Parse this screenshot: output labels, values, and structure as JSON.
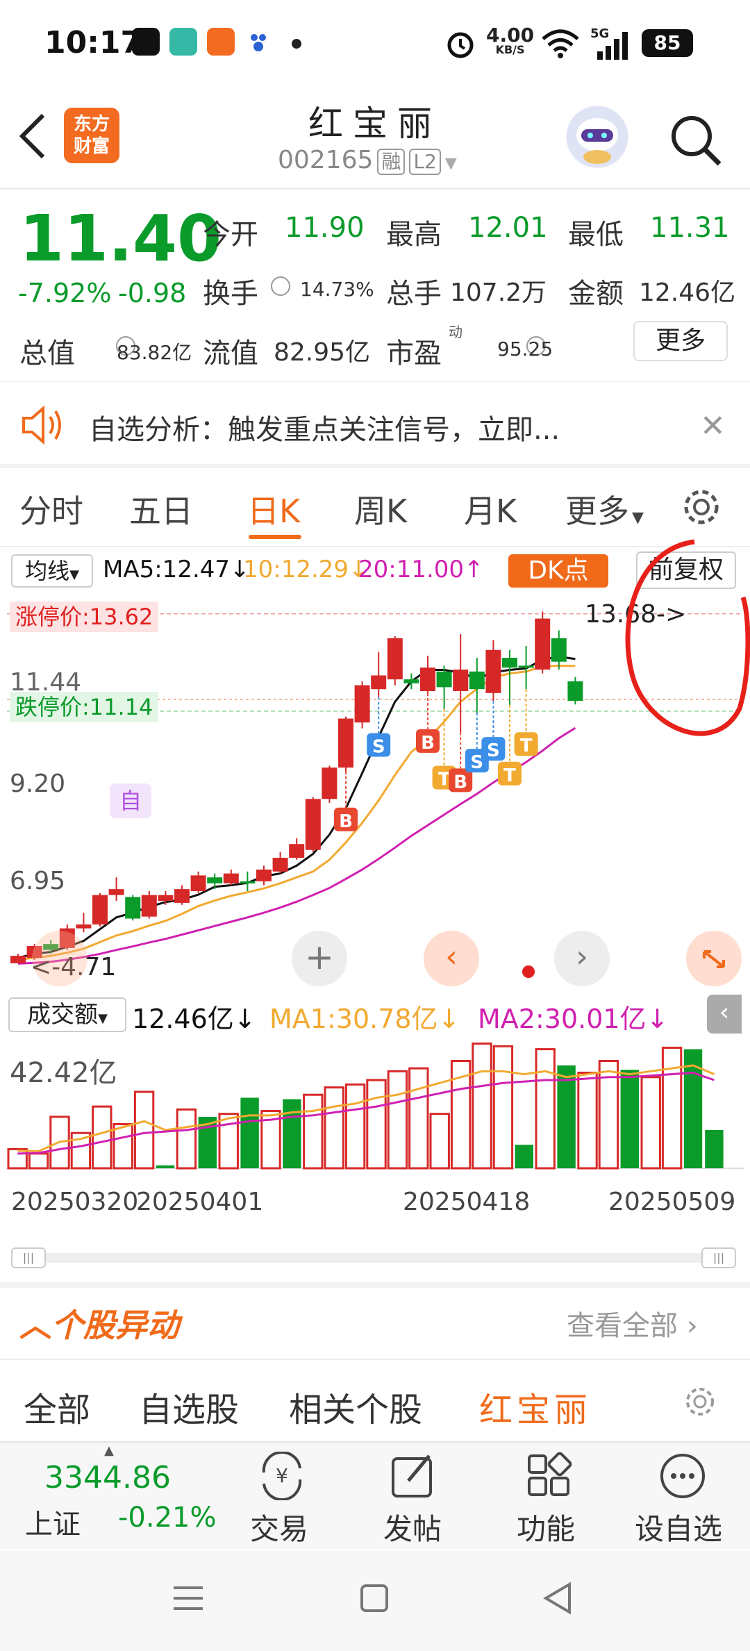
{
  "status_bar": {
    "time": "10:17",
    "net_speed": "4.00",
    "net_unit": "KB/S",
    "signal": "5G",
    "battery": "85"
  },
  "header": {
    "logo_line1": "东方",
    "logo_line2": "财富",
    "stock_name": "红宝丽",
    "stock_code": "002165",
    "tag_margin": "融",
    "tag_level": "L2"
  },
  "quote": {
    "price": "11.40",
    "change_pct": "-7.92%",
    "change_amt": "-0.98",
    "open_label": "今开",
    "open": "11.90",
    "high_label": "最高",
    "high": "12.01",
    "low_label": "最低",
    "low": "11.31",
    "turnover_label": "换手",
    "turnover": "14.73%",
    "volume_label": "总手",
    "volume": "107.2万",
    "amount_label": "金额",
    "amount": "12.46亿",
    "mktcap_label": "总值",
    "mktcap": "83.82亿",
    "float_label": "流值",
    "float": "82.95亿",
    "pe_label": "市盈",
    "pe_sup": "动",
    "pe": "95.25",
    "more": "更多"
  },
  "notice": {
    "text": "自选分析：触发重点关注信号，立即..."
  },
  "tabs": [
    {
      "label": "分时"
    },
    {
      "label": "五日"
    },
    {
      "label": "日K"
    },
    {
      "label": "周K"
    },
    {
      "label": "月K"
    },
    {
      "label": "更多"
    }
  ],
  "chart_toolbar": {
    "ma_select": "均线",
    "ma5": "MA5:12.47",
    "ma10": "10:12.29",
    "ma20": "20:11.00",
    "dk_button": "DK点",
    "fq_button": "前复权"
  },
  "chart_labels": {
    "limit_up": "涨停价:13.62",
    "limit_down": "跌停价:11.14",
    "y_top": "11.44",
    "y_mid": "9.20",
    "y_low": "6.95",
    "max_price": "13.68->",
    "min_price": "<-4.71",
    "self_marker": "自"
  },
  "volume_toolbar": {
    "select": "成交额",
    "value": "12.46亿",
    "ma1": "MA1:30.78亿",
    "ma2": "MA2:30.01亿",
    "max": "42.42亿"
  },
  "x_axis": [
    "20250320",
    "20250401",
    "20250418",
    "20250509"
  ],
  "colors": {
    "up": "#d72828",
    "down": "#0a9b2a",
    "accent": "#f06a1a",
    "ma5": "#111111",
    "ma10": "#f2a930",
    "ma20": "#d020b0"
  },
  "chart_data": {
    "type": "candlestick",
    "candles": [
      {
        "o": 4.71,
        "c": 4.9,
        "h": 4.95,
        "l": 4.71
      },
      {
        "o": 4.85,
        "c": 5.15,
        "h": 5.2,
        "l": 4.8
      },
      {
        "o": 5.2,
        "c": 5.05,
        "h": 5.3,
        "l": 4.95
      },
      {
        "o": 5.1,
        "c": 5.6,
        "h": 5.7,
        "l": 5.05
      },
      {
        "o": 5.6,
        "c": 5.7,
        "h": 6.0,
        "l": 5.5
      },
      {
        "o": 5.7,
        "c": 6.45,
        "h": 6.5,
        "l": 5.65
      },
      {
        "o": 6.45,
        "c": 6.6,
        "h": 6.9,
        "l": 6.3
      },
      {
        "o": 6.4,
        "c": 5.85,
        "h": 6.45,
        "l": 5.8
      },
      {
        "o": 5.9,
        "c": 6.45,
        "h": 6.55,
        "l": 5.85
      },
      {
        "o": 6.3,
        "c": 6.45,
        "h": 6.55,
        "l": 6.2
      },
      {
        "o": 6.25,
        "c": 6.6,
        "h": 6.7,
        "l": 6.2
      },
      {
        "o": 6.55,
        "c": 6.95,
        "h": 7.05,
        "l": 6.5
      },
      {
        "o": 6.9,
        "c": 6.75,
        "h": 7.0,
        "l": 6.6
      },
      {
        "o": 6.75,
        "c": 7.0,
        "h": 7.1,
        "l": 6.7
      },
      {
        "o": 6.8,
        "c": 6.75,
        "h": 7.05,
        "l": 6.55
      },
      {
        "o": 6.8,
        "c": 7.1,
        "h": 7.2,
        "l": 6.7
      },
      {
        "o": 7.05,
        "c": 7.4,
        "h": 7.55,
        "l": 7.0
      },
      {
        "o": 7.4,
        "c": 7.75,
        "h": 7.9,
        "l": 7.35
      },
      {
        "o": 7.6,
        "c": 8.9,
        "h": 8.95,
        "l": 7.55
      },
      {
        "o": 8.9,
        "c": 9.7,
        "h": 9.75,
        "l": 8.8
      },
      {
        "o": 9.7,
        "c": 10.95,
        "h": 11.0,
        "l": 9.6
      },
      {
        "o": 10.85,
        "c": 11.8,
        "h": 11.9,
        "l": 10.7
      },
      {
        "o": 11.7,
        "c": 12.05,
        "h": 12.65,
        "l": 11.5
      },
      {
        "o": 11.95,
        "c": 13.0,
        "h": 13.05,
        "l": 11.8
      },
      {
        "o": 11.95,
        "c": 11.85,
        "h": 12.1,
        "l": 11.7
      },
      {
        "o": 11.65,
        "c": 12.25,
        "h": 12.55,
        "l": 11.6
      },
      {
        "o": 12.15,
        "c": 11.75,
        "h": 12.3,
        "l": 11.2
      },
      {
        "o": 11.65,
        "c": 12.2,
        "h": 13.1,
        "l": 10.6
      },
      {
        "o": 12.15,
        "c": 11.7,
        "h": 12.5,
        "l": 11.1
      },
      {
        "o": 11.6,
        "c": 12.7,
        "h": 12.95,
        "l": 11.4
      },
      {
        "o": 12.5,
        "c": 12.25,
        "h": 12.7,
        "l": 11.3
      },
      {
        "o": 12.3,
        "c": 12.25,
        "h": 12.8,
        "l": 11.7
      },
      {
        "o": 12.2,
        "c": 13.5,
        "h": 13.68,
        "l": 12.1
      },
      {
        "o": 13.0,
        "c": 12.4,
        "h": 13.2,
        "l": 12.2
      },
      {
        "o": 11.9,
        "c": 11.4,
        "h": 12.01,
        "l": 11.31
      }
    ],
    "ma5": [
      4.85,
      4.95,
      5.0,
      5.13,
      5.28,
      5.58,
      5.88,
      6.0,
      6.15,
      6.27,
      6.33,
      6.46,
      6.66,
      6.7,
      6.76,
      6.93,
      7.0,
      7.2,
      7.5,
      7.99,
      8.66,
      9.56,
      10.48,
      11.38,
      11.9,
      12.19,
      12.19,
      12.12,
      11.97,
      12.13,
      12.19,
      12.23,
      12.45,
      12.53,
      12.47
    ],
    "ma10": [
      4.8,
      4.85,
      4.9,
      4.98,
      5.08,
      5.25,
      5.42,
      5.53,
      5.67,
      5.79,
      5.97,
      6.17,
      6.31,
      6.43,
      6.52,
      6.62,
      6.75,
      6.9,
      7.05,
      7.35,
      7.79,
      8.29,
      8.86,
      9.51,
      10.1,
      10.42,
      10.87,
      11.38,
      11.71,
      12.0,
      12.1,
      12.15,
      12.28,
      12.3,
      12.29
    ],
    "ma20": [
      4.7,
      4.72,
      4.75,
      4.8,
      4.87,
      4.95,
      5.05,
      5.14,
      5.24,
      5.33,
      5.44,
      5.55,
      5.66,
      5.77,
      5.88,
      6.0,
      6.13,
      6.28,
      6.45,
      6.63,
      6.86,
      7.1,
      7.37,
      7.66,
      7.96,
      8.23,
      8.5,
      8.77,
      9.03,
      9.32,
      9.58,
      9.84,
      10.13,
      10.45,
      10.71
    ],
    "volume": [
      {
        "v": 6.5,
        "up": true
      },
      {
        "v": 5.0,
        "up": true
      },
      {
        "v": 17.5,
        "up": true
      },
      {
        "v": 12,
        "up": true
      },
      {
        "v": 21,
        "up": true
      },
      {
        "v": 15,
        "up": true
      },
      {
        "v": 26,
        "up": true
      },
      {
        "v": 1,
        "up": false
      },
      {
        "v": 20,
        "up": true
      },
      {
        "v": 17.5,
        "up": false
      },
      {
        "v": 18.5,
        "up": true
      },
      {
        "v": 24,
        "up": false
      },
      {
        "v": 19.5,
        "up": true
      },
      {
        "v": 23.5,
        "up": false
      },
      {
        "v": 25,
        "up": true
      },
      {
        "v": 27.5,
        "up": true
      },
      {
        "v": 28.5,
        "up": true
      },
      {
        "v": 30,
        "up": true
      },
      {
        "v": 33,
        "up": true
      },
      {
        "v": 34,
        "up": true
      },
      {
        "v": 18.5,
        "up": true
      },
      {
        "v": 36.5,
        "up": true
      },
      {
        "v": 42.42,
        "up": true
      },
      {
        "v": 41.5,
        "up": true
      },
      {
        "v": 8,
        "up": false
      },
      {
        "v": 40.5,
        "up": true
      },
      {
        "v": 35,
        "up": false
      },
      {
        "v": 32.5,
        "up": true
      },
      {
        "v": 36.5,
        "up": true
      },
      {
        "v": 33.5,
        "up": false
      },
      {
        "v": 31,
        "up": true
      },
      {
        "v": 41,
        "up": true
      },
      {
        "v": 40.5,
        "up": false
      },
      {
        "v": 13,
        "up": false
      }
    ],
    "vol_ma1": [
      6,
      5.8,
      9,
      10,
      12,
      14,
      16,
      13,
      14,
      15,
      17,
      18,
      18,
      19,
      19.5,
      21,
      22,
      24,
      25,
      27,
      29,
      31,
      33,
      33,
      32,
      33,
      31,
      32,
      33,
      32,
      33,
      34,
      35,
      32
    ],
    "vol_ma2": [
      5,
      5.2,
      6.5,
      7.5,
      9,
      10.5,
      12,
      12.5,
      13,
      14,
      15,
      16,
      16.5,
      17.5,
      18,
      19,
      20,
      21,
      22.5,
      24,
      25.5,
      27,
      28,
      29,
      29.5,
      30,
      30,
      30.5,
      31,
      31,
      31.5,
      32,
      32.5,
      30.01
    ],
    "bs_markers": [
      {
        "index": 20,
        "label": "B",
        "color": "#e8472f"
      },
      {
        "index": 22,
        "label": "S",
        "color": "#3b8fe8"
      },
      {
        "index": 25,
        "label": "B",
        "color": "#e8472f"
      },
      {
        "index": 26,
        "label": "T",
        "color": "#f2a930"
      },
      {
        "index": 27,
        "label": "B",
        "color": "#e8472f"
      },
      {
        "index": 28,
        "label": "S",
        "color": "#3b8fe8"
      },
      {
        "index": 29,
        "label": "S",
        "color": "#3b8fe8"
      },
      {
        "index": 30,
        "label": "T",
        "color": "#f2a930"
      },
      {
        "index": 31,
        "label": "T",
        "color": "#f2a930"
      }
    ]
  },
  "news": {
    "title": "个股异动",
    "view_all": "查看全部",
    "tabs": [
      "全部",
      "自选股",
      "相关个股",
      "红宝丽"
    ]
  },
  "bottom_bar": {
    "index_value": "3344.86",
    "index_name": "上证",
    "index_change": "-0.21%",
    "trade": "交易",
    "post": "发帖",
    "function": "功能",
    "add_watch": "设自选"
  }
}
